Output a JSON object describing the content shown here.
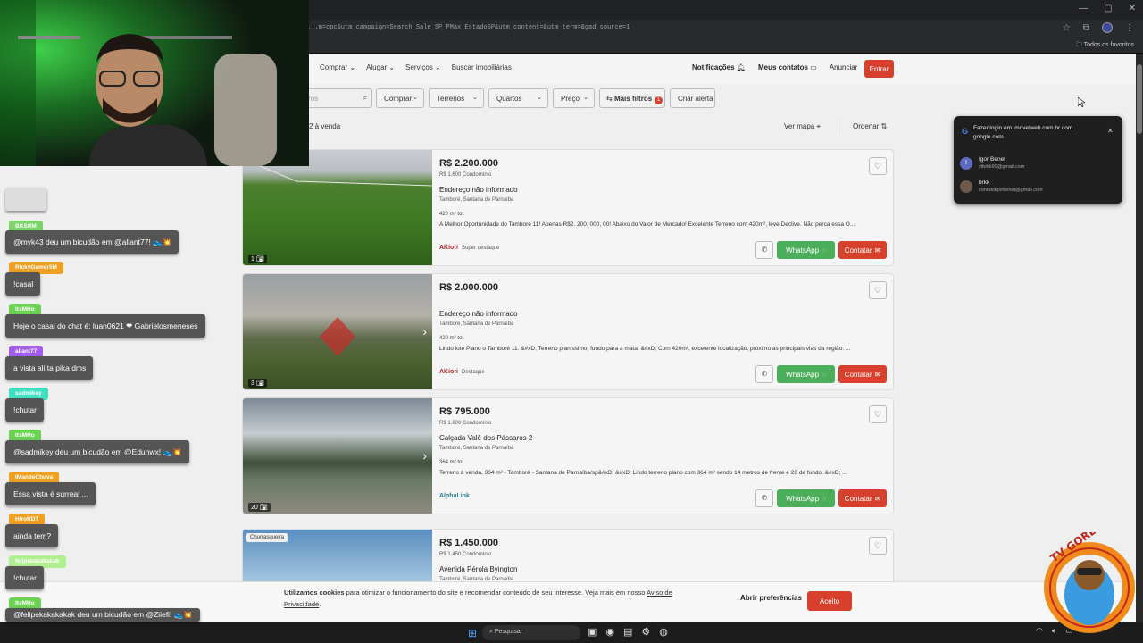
{
  "browser": {
    "url": "...m=cpc&utm_campaign=Search_Sale_SP_PMax_EstadoSP&utm_content=&utm_term=&gad_source=1",
    "bookmarks_label": "Todos os favoritos"
  },
  "header": {
    "nav": [
      "Comprar",
      "Alugar",
      "Serviços",
      "Buscar imobiliárias"
    ],
    "notificacoes": "Notificações",
    "meus_contatos": "Meus contatos",
    "anunciar": "Anunciar",
    "entrar": "Entrar"
  },
  "filters": {
    "search_placeholder": "ros",
    "comprar": "Comprar",
    "terrenos": "Terrenos",
    "quartos": "Quartos",
    "preco": "Preço",
    "mais_filtros": "Mais filtros",
    "mais_filtros_count": "1",
    "criar_alerta": "Criar alerta"
  },
  "results": {
    "text": "2 à venda",
    "ver_mapa": "Ver mapa",
    "ordenar": "Ordenar"
  },
  "listings": [
    {
      "price": "R$ 2.200.000",
      "condo": "R$ 1.600 Condomínio",
      "address": "Endereço não informado",
      "location": "Tamboré, Santana de Parnaíba",
      "area": "420 m² tot.",
      "description": "A Melhor Oportunidade do Tamboré 11! Apenas R$2. 200. 000, 00! Abaixo do Valor de Mercado! Excelente Terreno com 420m², leve Declive. Não perca essa O...",
      "img_count": "1",
      "badge": "Super destaque",
      "brand": "AKiori"
    },
    {
      "price": "R$ 2.000.000",
      "condo": "",
      "address": "Endereço não informado",
      "location": "Tamboré, Santana de Parnaíba",
      "area": "420 m² tot.",
      "description": "Lindo lote Plano o Tamboré 11. &#xD; Terreno planíssimo, fundo para a mata. &#xD; Com 420m², excelente localização, próximo as principais vias da região. ...",
      "img_count": "3",
      "badge": "Destaque",
      "brand": "AKiori"
    },
    {
      "price": "R$ 795.000",
      "condo": "R$ 1.600 Condomínio",
      "address": "Calçada Valê dos Pássaros 2",
      "location": "Tamboré, Santana de Parnaíba",
      "area": "364 m² tot.",
      "description": "Terreno à venda, 364 m² - Tamboré - Santana de Parnaíba/sp&#xD; &#xD; Lindo terreno plano com 364 m² sendo 14 metros de frente e 26 de fundo. &#xD; ...",
      "img_count": "20",
      "badge": "",
      "brand": "AlphaLink"
    },
    {
      "price": "R$ 1.450.000",
      "condo": "R$ 1.450 Condomínio",
      "address": "Avenida Pérola Byington",
      "location": "Tamboré, Santana de Parnaíba",
      "tag": "Churrasqueira"
    }
  ],
  "buttons": {
    "whatsapp": "WhatsApp",
    "contatar": "Contatar"
  },
  "cookie": {
    "bold": "Utilizamos cookies",
    "text": " para otimizar o funcionamento do site e recomendar conteúdo de seu interesse. Veja mais em nosso ",
    "link": "Aviso de Privacidade",
    "end": ".",
    "prefs": "Abrir preferências",
    "accept": "Aceito"
  },
  "google_popup": {
    "title": "Fazer login em imovelweb.com.br com google.com",
    "accounts": [
      {
        "initial": "I",
        "name": "Igor Benet",
        "email": "ytbrkk99@gmail.com"
      },
      {
        "initial": "",
        "name": "brkk",
        "email": "contatoigorbenet@gmail.com"
      }
    ]
  },
  "taskbar": {
    "search": "Pesquisar"
  },
  "chat": [
    {
      "user": "",
      "user_color": "#cfcfcf",
      "msg": ""
    },
    {
      "user": "BKSRM",
      "user_color": "#7bd36a",
      "msg": "@myk43 deu um bicudão em @allant77! 👟💥"
    },
    {
      "user": "RickyGamer5M",
      "user_color": "#f0a020",
      "msg": "!casal"
    },
    {
      "user": "ItsMHo",
      "user_color": "#6ad352",
      "msg": "Hoje o casal do chat é: luan0621 ❤ Gabrielosmeneses"
    },
    {
      "user": "allant77",
      "user_color": "#a35cf0",
      "msg": "a vista ali ta pika dms"
    },
    {
      "user": "sadmikey",
      "user_color": "#3fe0c0",
      "msg": "!chutar"
    },
    {
      "user": "ItsMHo",
      "user_color": "#6ad352",
      "msg": "@sadmikey deu um bicudão em @Eduhwx! 👟💥"
    },
    {
      "user": "IMandeChuva",
      "user_color": "#f0a020",
      "msg": "Essa vista é surreal ..."
    },
    {
      "user": "HiroRDT",
      "user_color": "#f0a020",
      "msg": "ainda tem?"
    },
    {
      "user": "felipekakakakak",
      "user_color": "#b0f090",
      "msg": "!chutar"
    },
    {
      "user": "ItsMHo",
      "user_color": "#6ad352",
      "msg": "@felipekakakakak deu um bicudão em @Ziiefi! 👟💥"
    }
  ],
  "mascot": {
    "top_text": "TV GORDINHO"
  }
}
